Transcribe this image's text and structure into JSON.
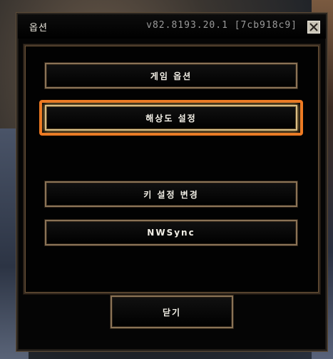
{
  "window": {
    "title": "옵션",
    "version": "v82.8193.20.1 [7cb918c9]"
  },
  "menu": {
    "game_options": "게임 옵션",
    "resolution_settings": "해상도 설정",
    "key_settings": "키 설정 변경",
    "nwsync": "NWSync"
  },
  "footer": {
    "close_label": "닫기"
  },
  "colors": {
    "highlight": "#f07a22",
    "border_gold": "#8a7356"
  }
}
